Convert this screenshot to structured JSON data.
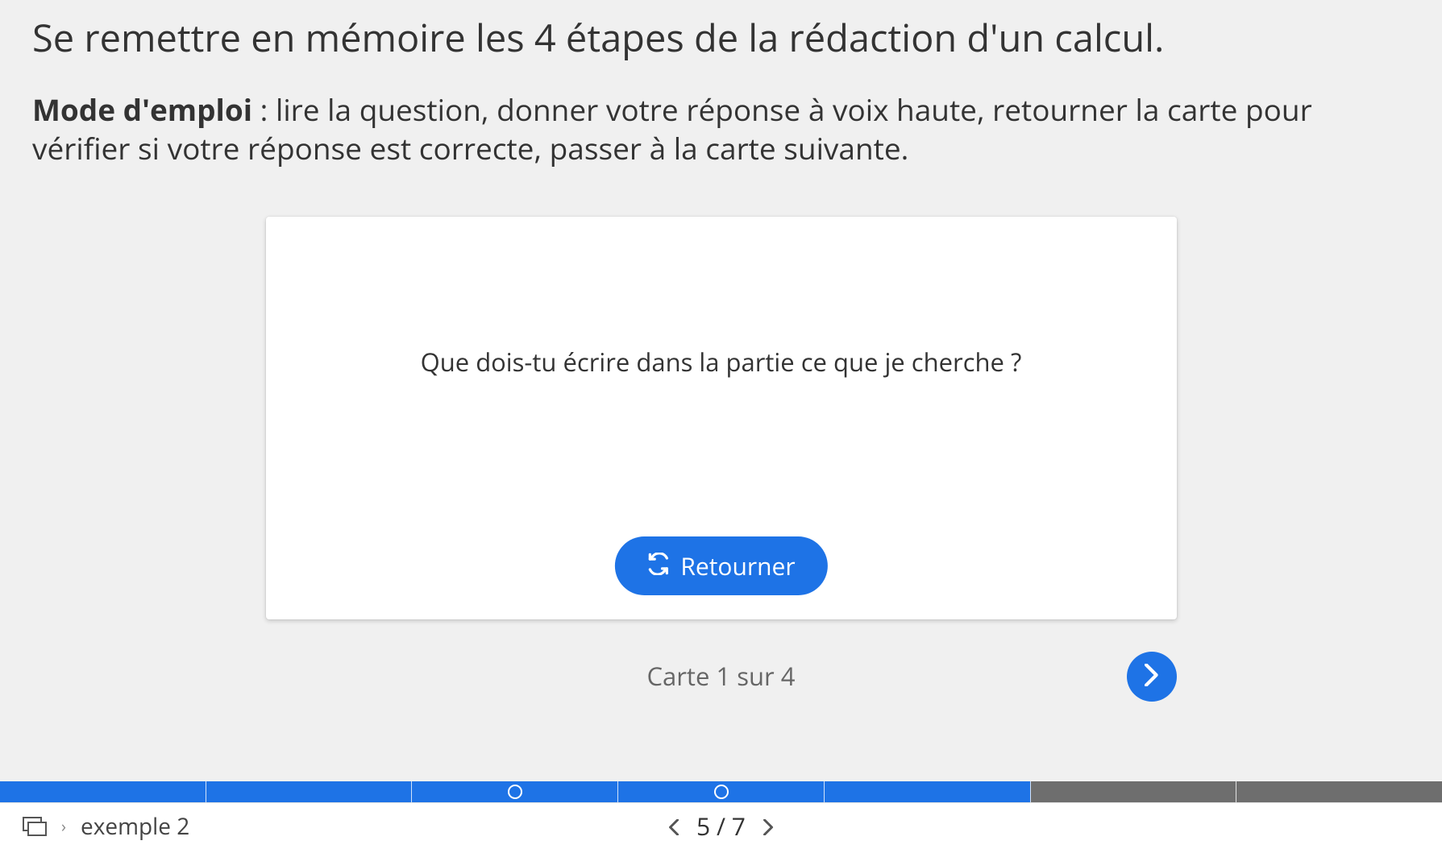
{
  "header": {
    "title": "Se remettre en mémoire les 4 étapes de la rédaction d'un calcul."
  },
  "instructions": {
    "label": "Mode d'emploi",
    "text": " : lire la question, donner votre réponse à voix haute, retourner la carte pour vérifier si votre réponse est correcte, passer à la carte suivante."
  },
  "card": {
    "question": "Que dois-tu écrire dans la partie ce que je cherche ?",
    "flip_label": "Retourner",
    "counter": "Carte 1 sur 4"
  },
  "progress": {
    "segments": [
      {
        "state": "done",
        "marker": false
      },
      {
        "state": "done",
        "marker": false
      },
      {
        "state": "done",
        "marker": true
      },
      {
        "state": "done",
        "marker": true
      },
      {
        "state": "current",
        "marker": false
      },
      {
        "state": "todo",
        "marker": false
      },
      {
        "state": "todo",
        "marker": false
      }
    ]
  },
  "footer": {
    "breadcrumb": "exemple 2",
    "page_label": "5 / 7"
  }
}
